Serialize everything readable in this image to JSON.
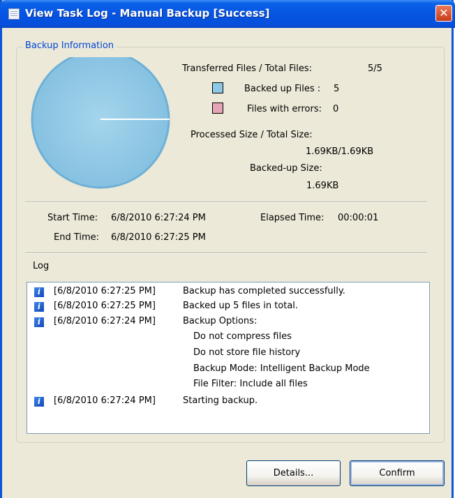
{
  "window": {
    "title": "View Task Log - Manual Backup [Success]",
    "close_glyph": "✕",
    "accent_color": "#0a55d8"
  },
  "backup_info": {
    "legend": "Backup Information",
    "pie": {
      "backed_up_files": 5,
      "files_with_errors": 0,
      "backed_up_color": "#8dc9e6",
      "errors_color": "#e3a5b8"
    },
    "transferred_label": "Transferred Files / Total Files:",
    "transferred_value": "5/5",
    "backed_up_label": "Backed up Files :",
    "backed_up_value": "5",
    "errors_label": "Files with errors:",
    "errors_value": "0",
    "processed_label": "Processed Size / Total Size:",
    "processed_value": "1.69KB/1.69KB",
    "backedup_size_label": "Backed-up Size:",
    "backedup_size_value": "1.69KB"
  },
  "times": {
    "start_label": "Start Time:",
    "start_value": "6/8/2010 6:27:24 PM",
    "end_label": "End Time:",
    "end_value": "6/8/2010 6:27:25 PM",
    "elapsed_label": "Elapsed Time:",
    "elapsed_value": "00:00:01"
  },
  "log": {
    "label": "Log",
    "icon": "info-icon",
    "entries": [
      {
        "time": "[6/8/2010 6:27:25 PM]",
        "message": "Backup has completed successfully."
      },
      {
        "time": "[6/8/2010 6:27:25 PM]",
        "message": "Backed up 5 files in total."
      },
      {
        "time": "[6/8/2010 6:27:24 PM]",
        "message": "Backup Options:",
        "details": [
          "Do not compress files",
          "Do not store file history",
          "Backup Mode: Intelligent Backup Mode",
          "File Filter: Include all files"
        ]
      },
      {
        "time": "[6/8/2010 6:27:24 PM]",
        "message": "Starting backup."
      }
    ]
  },
  "buttons": {
    "details_label": "Details...",
    "confirm_label": "Confirm"
  }
}
